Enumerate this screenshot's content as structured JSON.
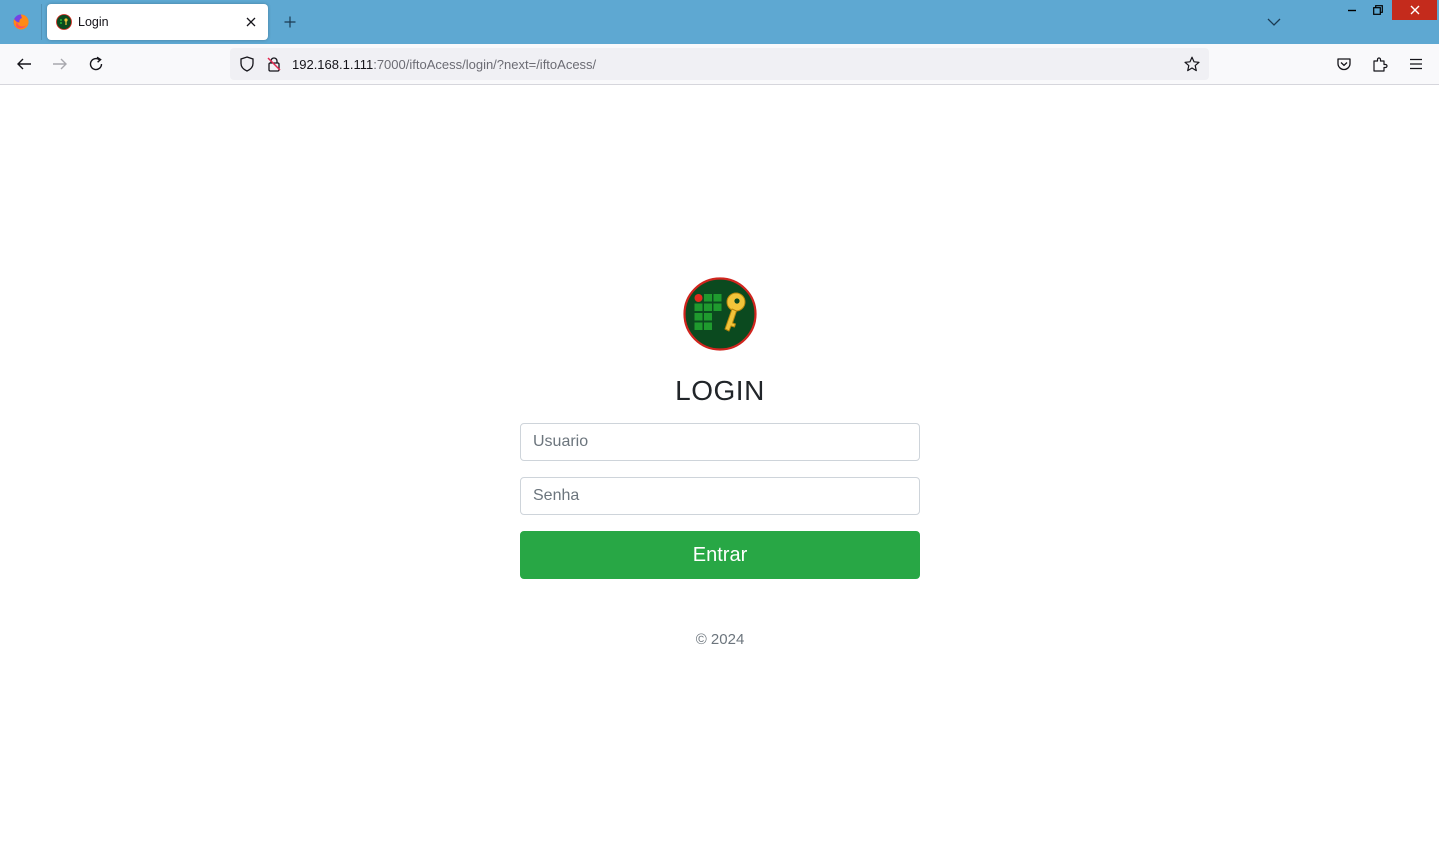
{
  "browser": {
    "tab": {
      "title": "Login",
      "close_icon": "close-icon"
    },
    "url": {
      "host": "192.168.1.111",
      "path": ":7000/iftoAcess/login/?next=/iftoAcess/"
    },
    "colors": {
      "tabstrip": "#5ea8d2",
      "close_button": "#c42b1c"
    }
  },
  "page": {
    "heading": "LOGIN",
    "username": {
      "placeholder": "Usuario",
      "value": ""
    },
    "password": {
      "placeholder": "Senha",
      "value": ""
    },
    "submit_label": "Entrar",
    "footer": "© 2024",
    "colors": {
      "button": "#28a745",
      "logo_bg": "#0b4a1f",
      "logo_border": "#d0251e",
      "logo_key": "#f2c43a",
      "logo_squares": "#1f9a2e",
      "logo_dot": "#e32b1f"
    }
  }
}
